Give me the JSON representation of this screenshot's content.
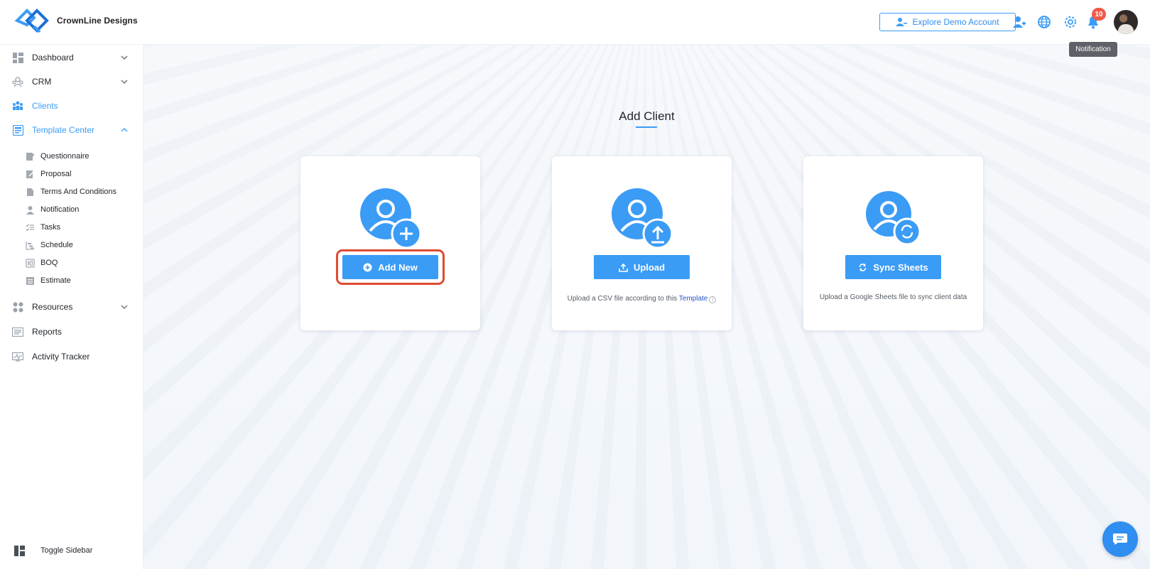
{
  "header": {
    "brand": "CrownLine Designs",
    "demo_button": "Explore Demo Account",
    "notification_count": "10",
    "tooltip": "Notification",
    "icons": [
      "add-user-icon",
      "globe-icon",
      "gear-icon",
      "bell-icon"
    ]
  },
  "sidebar": {
    "items": [
      {
        "label": "Dashboard",
        "icon": "dashboard-icon",
        "expandable": true
      },
      {
        "label": "CRM",
        "icon": "crm-icon",
        "expandable": true
      },
      {
        "label": "Clients",
        "icon": "clients-icon",
        "active": true
      },
      {
        "label": "Template Center",
        "icon": "template-icon",
        "expanded": true,
        "active": true
      },
      {
        "label": "Resources",
        "icon": "resources-icon",
        "expandable": true
      },
      {
        "label": "Reports",
        "icon": "reports-icon"
      },
      {
        "label": "Activity Tracker",
        "icon": "activity-icon"
      }
    ],
    "subitems": [
      {
        "label": "Questionnaire"
      },
      {
        "label": "Proposal"
      },
      {
        "label": "Terms And Conditions"
      },
      {
        "label": "Notification"
      },
      {
        "label": "Tasks"
      },
      {
        "label": "Schedule"
      },
      {
        "label": "BOQ"
      },
      {
        "label": "Estimate"
      }
    ],
    "toggle_label": "Toggle Sidebar"
  },
  "main": {
    "title": "Add Client",
    "cards": [
      {
        "button": "Add New",
        "icon": "plus-circle-icon"
      },
      {
        "button": "Upload",
        "icon": "upload-icon",
        "help_text": "Upload a CSV file according to this ",
        "help_link": "Template"
      },
      {
        "button": "Sync Sheets",
        "icon": "sync-icon",
        "help_text": "Upload a Google Sheets file to sync client data"
      }
    ]
  },
  "colors": {
    "accent": "#3b9cf5",
    "badge": "#ef5b4a",
    "highlight": "#df4a32"
  }
}
